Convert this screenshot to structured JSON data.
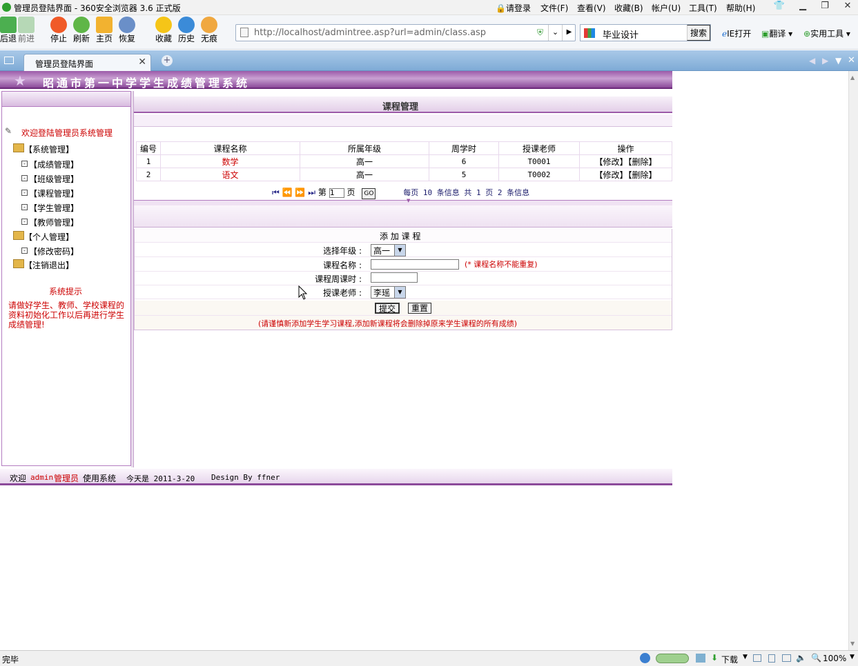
{
  "window": {
    "title": "管理员登陆界面 - 360安全浏览器 3.6 正式版",
    "menus": [
      "请登录",
      "文件(F)",
      "查看(V)",
      "收藏(B)",
      "帐户(U)",
      "工具(T)",
      "帮助(H)"
    ]
  },
  "toolbar": {
    "back": "后退",
    "forward": "前进",
    "stop": "停止",
    "refresh": "刷新",
    "home": "主页",
    "restore": "恢复",
    "favorites": "收藏",
    "history": "历史",
    "incognito": "无痕",
    "url": "http://localhost/admintree.asp?url=admin/class.asp",
    "search_value": "毕业设计",
    "search_button": "搜索",
    "ie_open": "IE打开",
    "translate": "翻译",
    "tools": "实用工具"
  },
  "tab": {
    "label": "管理员登陆界面"
  },
  "site": {
    "banner_title": "昭通市第一中学学生成绩管理系统"
  },
  "sidebar": {
    "welcome": "欢迎登陆管理员系统管理",
    "system_group": "【系统管理】",
    "system_items": [
      "【成绩管理】",
      "【班级管理】",
      "【课程管理】",
      "【学生管理】",
      "【教师管理】"
    ],
    "personal_group": "【个人管理】",
    "personal_items": [
      "【修改密码】"
    ],
    "logout": "【注销退出】",
    "tip_title": "系统提示",
    "tip_text": "请做好学生、教师、学校课程的资料初始化工作以后再进行学生成绩管理!"
  },
  "main": {
    "page_title": "课程管理",
    "columns": [
      "编号",
      "课程名称",
      "所属年级",
      "周学时",
      "授课老师",
      "操作"
    ],
    "rows": [
      {
        "id": "1",
        "name": "数学",
        "grade": "高一",
        "hours": "6",
        "teacher": "T0001"
      },
      {
        "id": "2",
        "name": "语文",
        "grade": "高一",
        "hours": "5",
        "teacher": "T0002"
      }
    ],
    "action_edit": "【修改】",
    "action_delete": "【删除】",
    "pagination": {
      "page_prefix": "第",
      "page_value": "1",
      "page_suffix": "页",
      "go_label": "GO",
      "summary": "每页 10 条信息 共 1 页 2 条信息"
    }
  },
  "form": {
    "title": "添 加 课 程",
    "grade_label": "选择年级 :",
    "grade_value": "高一",
    "name_label": "课程名称 :",
    "name_hint": "(* 课程名称不能重复)",
    "hours_label": "课程周课时 :",
    "teacher_label": "授课老师 :",
    "teacher_value": "李瑶",
    "submit": "提交",
    "reset": "重置",
    "warning": "(请谨慎新添加学生学习课程,添加新课程将会删除掉原来学生课程的所有成绩)"
  },
  "footer": {
    "welcome": "欢迎",
    "user": "admin",
    "role": "管理员",
    "using": "使用系统",
    "today": "今天是 2011-3-20",
    "design": "Design By ffner"
  },
  "statusbar": {
    "status": "完毕",
    "download": "下载",
    "zoom": "100%"
  }
}
